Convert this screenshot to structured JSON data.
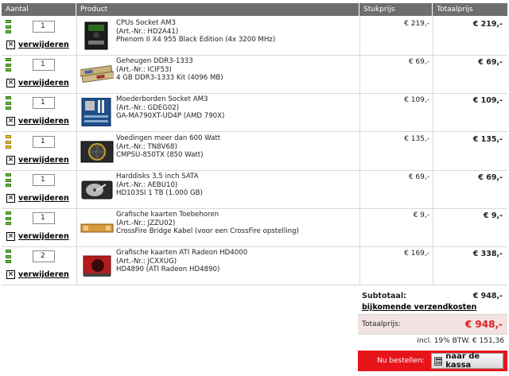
{
  "headers": {
    "aantal": "Aantal",
    "product": "Product",
    "stukprijs": "Stukprijs",
    "totaalprijs": "Totaalprijs"
  },
  "remove_label": "verwijderen",
  "items": [
    {
      "qty": "1",
      "stock": "green",
      "category": "CPUs Socket AM3",
      "artnr": "(Art.-Nr.: HD2A41)",
      "name": "Phenom II X4 955 Black Edition (4x 3200 MHz)",
      "unit": "€ 219,-",
      "total": "€ 219,-",
      "icon": "cpu-box-image"
    },
    {
      "qty": "1",
      "stock": "green",
      "category": "Geheugen DDR3-1333",
      "artnr": "(Art.-Nr.: ICIF53)",
      "name": "4 GB DDR3-1333 Kit (4096 MB)",
      "unit": "€ 69,-",
      "total": "€ 69,-",
      "icon": "ram-modules-image"
    },
    {
      "qty": "1",
      "stock": "green",
      "category": "Moederborden Socket AM3",
      "artnr": "(Art.-Nr.: GDEG02)",
      "name": "GA-MA790XT-UD4P (AMD 790X)",
      "unit": "€ 109,-",
      "total": "€ 109,-",
      "icon": "motherboard-image"
    },
    {
      "qty": "1",
      "stock": "yellow",
      "category": "Voedingen meer dan 600 Watt",
      "artnr": "(Art.-Nr.: TN8V68)",
      "name": "CMPSU-850TX (850 Watt)",
      "unit": "€ 135,-",
      "total": "€ 135,-",
      "icon": "power-supply-image"
    },
    {
      "qty": "1",
      "stock": "green",
      "category": "Harddisks 3,5 inch SATA",
      "artnr": "(Art.-Nr.: AEBU10)",
      "name": "HD103SI 1 TB (1.000 GB)",
      "unit": "€ 69,-",
      "total": "€ 69,-",
      "icon": "harddisk-image"
    },
    {
      "qty": "1",
      "stock": "green",
      "category": "Grafische kaarten Toebehoren",
      "artnr": "(Art.-Nr.: JZZU02)",
      "name": "CrossFire Bridge Kabel (voor een CrossFire opstelling)",
      "unit": "€ 9,-",
      "total": "€ 9,-",
      "icon": "crossfire-bridge-image"
    },
    {
      "qty": "2",
      "stock": "green",
      "category": "Grafische kaarten ATI Radeon HD4000",
      "artnr": "(Art.-Nr.: JCXXUG)",
      "name": "HD4890 (ATI Radeon HD4890)",
      "unit": "€ 169,-",
      "total": "€ 338,-",
      "icon": "graphics-card-image"
    }
  ],
  "summary": {
    "subtotal_label": "Subtotaal:",
    "subtotal_value": "€ 948,-",
    "shipping_link": "bijkomende verzendkosten",
    "total_label": "Totaalprijs:",
    "total_value": "€ 948,-",
    "vat": "incl. 19% BTW. € 151,36"
  },
  "checkout": {
    "prompt": "Nu bestellen:",
    "button": "naar de kassa"
  },
  "colors": {
    "header_bg": "#6e6e6e",
    "stock_green": "#5cbd2c",
    "stock_yellow": "#f0c419",
    "accent_red": "#e8141c",
    "total_bg": "#f2e2e2"
  }
}
